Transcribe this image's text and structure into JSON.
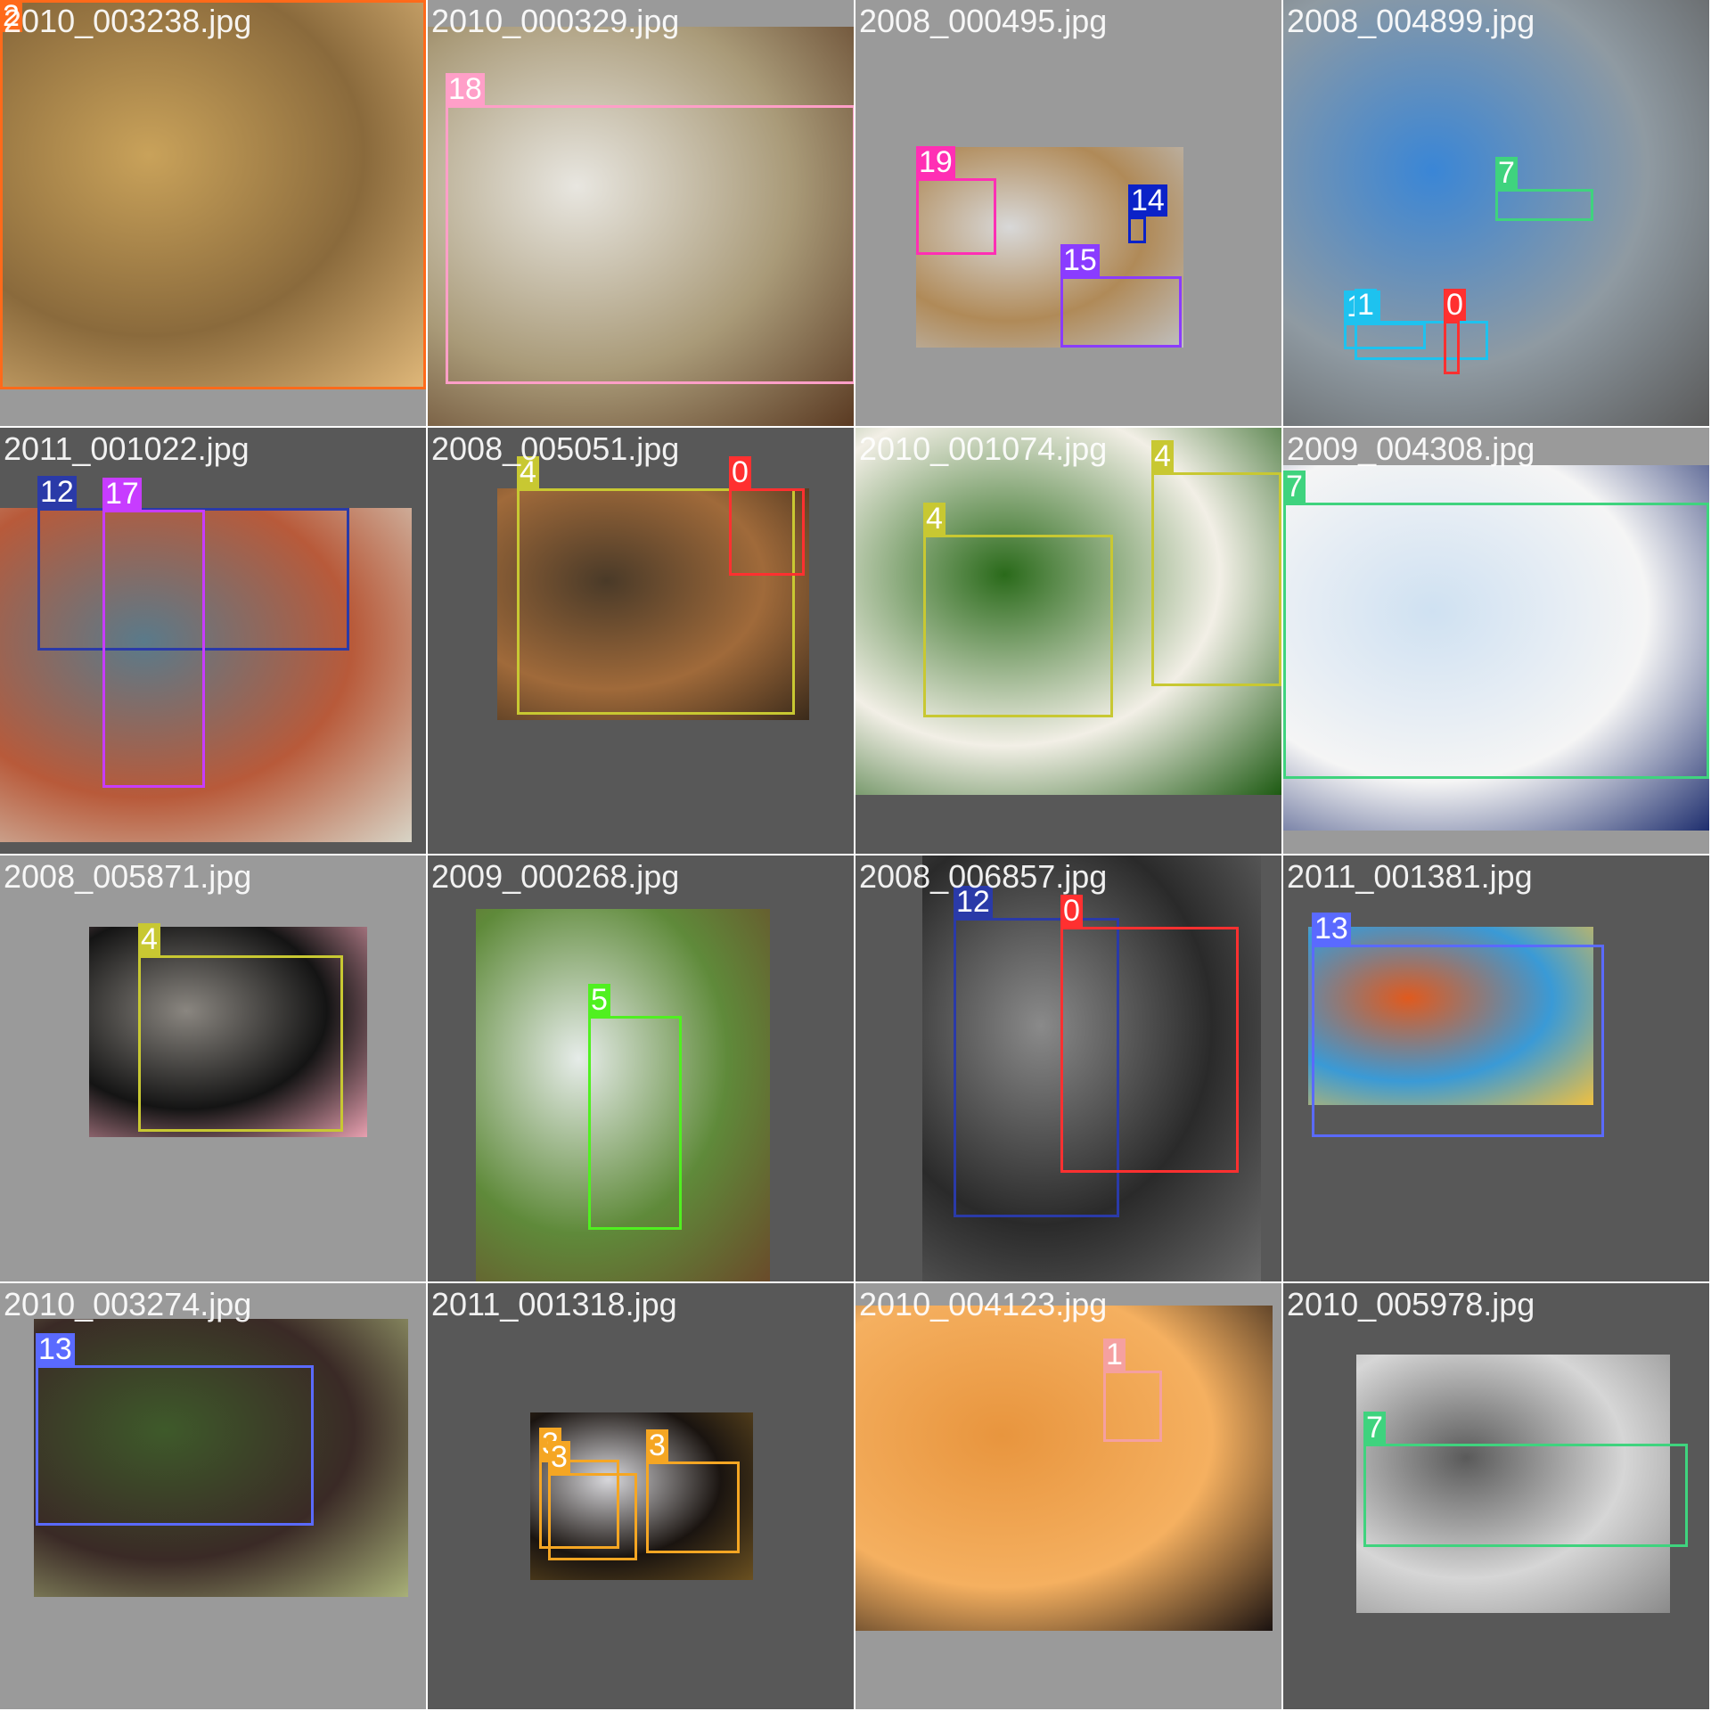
{
  "mosaic": {
    "tiles": [
      {
        "filename": "2010_003238.jpg",
        "theme": "light",
        "photo_colors": [
          "#c9a25a",
          "#8a6a3c",
          "#e0b87a"
        ],
        "boxes": [
          {
            "label": "2",
            "color": "#ff6a1a"
          }
        ]
      },
      {
        "filename": "2010_000329.jpg",
        "theme": "light",
        "photo_colors": [
          "#e8e6e0",
          "#a99a78",
          "#5a3a22"
        ],
        "boxes": [
          {
            "label": "18",
            "color": "#ff9fc8"
          }
        ]
      },
      {
        "filename": "2008_000495.jpg",
        "theme": "light",
        "photo_colors": [
          "#d8d8d8",
          "#b08a58",
          "#c0c0c0"
        ],
        "boxes": [
          {
            "label": "19",
            "color": "#ff2fb4"
          },
          {
            "label": "14",
            "color": "#0b22c8"
          },
          {
            "label": "15",
            "color": "#8a3cff"
          }
        ]
      },
      {
        "filename": "2008_004899.jpg",
        "theme": "light",
        "photo_colors": [
          "#3a86d6",
          "#8f9aa2",
          "#5a5a5a"
        ],
        "boxes": [
          {
            "label": "7",
            "color": "#3fd37e"
          },
          {
            "label": "11",
            "color": "#1ec2ef"
          },
          {
            "label": "1",
            "color": "#1ec2ef"
          },
          {
            "label": "0",
            "color": "#ff3030"
          }
        ]
      },
      {
        "filename": "2011_001022.jpg",
        "theme": "dark",
        "photo_colors": [
          "#5a7a8a",
          "#b85a3a",
          "#d8d4c6"
        ],
        "boxes": [
          {
            "label": "12",
            "color": "#2a3aa8"
          },
          {
            "label": "17",
            "color": "#c73cff"
          }
        ]
      },
      {
        "filename": "2008_005051.jpg",
        "theme": "dark",
        "photo_colors": [
          "#4a3a28",
          "#a06a3a",
          "#3a2a1a"
        ],
        "boxes": [
          {
            "label": "4",
            "color": "#c8c832"
          },
          {
            "label": "0",
            "color": "#ff3030"
          }
        ]
      },
      {
        "filename": "2010_001074.jpg",
        "theme": "dark",
        "photo_colors": [
          "#2a6a1a",
          "#f2efe6",
          "#1d5a12"
        ],
        "boxes": [
          {
            "label": "4",
            "color": "#c8c832"
          },
          {
            "label": "4",
            "color": "#c8c832"
          }
        ]
      },
      {
        "filename": "2009_004308.jpg",
        "theme": "light",
        "photo_colors": [
          "#cfe1f2",
          "#f5f5f5",
          "#1e2e6e"
        ],
        "boxes": [
          {
            "label": "7",
            "color": "#3fd37e"
          }
        ]
      },
      {
        "filename": "2008_005871.jpg",
        "theme": "light",
        "photo_colors": [
          "#8a8680",
          "#141414",
          "#e8a0b0"
        ],
        "boxes": [
          {
            "label": "4",
            "color": "#c8c832"
          }
        ]
      },
      {
        "filename": "2009_000268.jpg",
        "theme": "dark",
        "photo_colors": [
          "#e6ece9",
          "#5f8a3a",
          "#6a4a2a"
        ],
        "boxes": [
          {
            "label": "5",
            "color": "#50f020"
          }
        ]
      },
      {
        "filename": "2008_006857.jpg",
        "theme": "dark",
        "photo_colors": [
          "#8a8a8a",
          "#2a2a2a",
          "#6a6a6a"
        ],
        "boxes": [
          {
            "label": "12",
            "color": "#2a3aa8"
          },
          {
            "label": "0",
            "color": "#ff3030"
          }
        ]
      },
      {
        "filename": "2011_001381.jpg",
        "theme": "dark",
        "photo_colors": [
          "#e05a1e",
          "#3a9ad6",
          "#f0c040"
        ],
        "boxes": [
          {
            "label": "13",
            "color": "#5a6aff"
          }
        ]
      },
      {
        "filename": "2010_003274.jpg",
        "theme": "light",
        "photo_colors": [
          "#3e5a2a",
          "#3a2a26",
          "#a8b078"
        ],
        "boxes": [
          {
            "label": "13",
            "color": "#5a6aff"
          }
        ]
      },
      {
        "filename": "2011_001318.jpg",
        "theme": "dark",
        "photo_colors": [
          "#d8d8dc",
          "#1a1410",
          "#6a5020"
        ],
        "boxes": [
          {
            "label": "3",
            "color": "#f5a623"
          },
          {
            "label": "3",
            "color": "#f5a623"
          },
          {
            "label": "3",
            "color": "#f5a623"
          }
        ]
      },
      {
        "filename": "2010_004123.jpg",
        "theme": "light",
        "photo_colors": [
          "#e8953e",
          "#f5b060",
          "#1a1210"
        ],
        "boxes": [
          {
            "label": "1",
            "color": "#f5a0a0"
          }
        ]
      },
      {
        "filename": "2010_005978.jpg",
        "theme": "dark",
        "photo_colors": [
          "#5a5a5a",
          "#d6d6d6",
          "#8a8a8a"
        ],
        "boxes": [
          {
            "label": "7",
            "color": "#3fd37e"
          }
        ]
      }
    ]
  }
}
